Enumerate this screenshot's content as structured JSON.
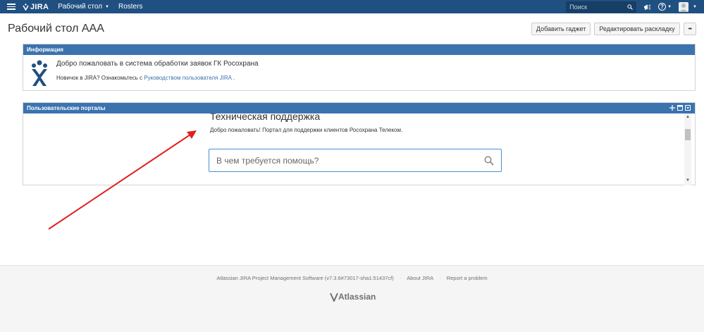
{
  "topnav": {
    "logo": "JIRA",
    "items": [
      {
        "label": "Рабочий стол",
        "has_caret": true
      },
      {
        "label": "Rosters",
        "has_caret": false
      }
    ],
    "search_placeholder": "Поиск",
    "help_symbol": "?"
  },
  "header": {
    "title": "Рабочий стол AAA",
    "add_gadget": "Добавить гаджет",
    "edit_layout": "Редактировать раскладку",
    "more": "•••"
  },
  "info_gadget": {
    "title": "Информация",
    "welcome": "Добро пожаловать в система обработки заявок ГК Росохрана",
    "newbie_prefix": "Новичок в JIRA? Ознакомьтесь с ",
    "newbie_link": "Руководством пользователя JIRA",
    "newbie_suffix": " ."
  },
  "portal_gadget": {
    "title": "Пользовательские порталы",
    "portal_title": "Техническая поддержка",
    "portal_desc": "Добро пожаловать! Портал для поддержки клиентов Росохрана Телеком.",
    "search_placeholder": "В чем требуется помощь?"
  },
  "footer": {
    "software": "Atlassian JIRA Project Management Software (v7.3.6#73017-sha1:51437cf)",
    "about": "About JIRA",
    "report": "Report a problem",
    "brand": "Atlassian"
  },
  "colors": {
    "nav_bg": "#205081",
    "gadget_header": "#3b73af",
    "annotation_arrow": "#e02020"
  }
}
